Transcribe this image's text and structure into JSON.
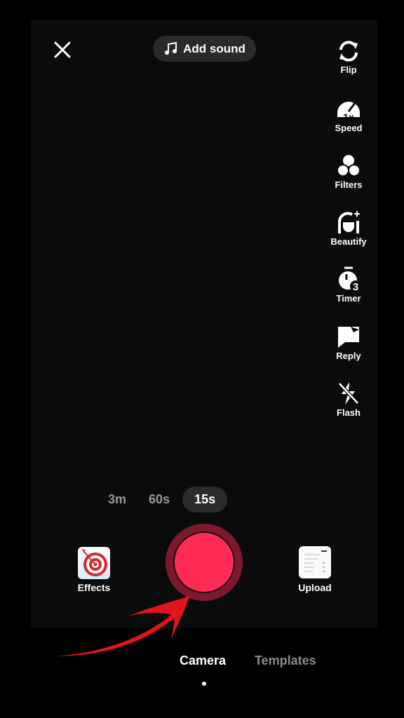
{
  "top": {
    "add_sound_label": "Add sound"
  },
  "side_tools": [
    {
      "label": "Flip",
      "icon": "flip-icon"
    },
    {
      "label": "Speed",
      "icon": "speed-icon",
      "badge": "1x"
    },
    {
      "label": "Filters",
      "icon": "filters-icon"
    },
    {
      "label": "Beautify",
      "icon": "beautify-icon"
    },
    {
      "label": "Timer",
      "icon": "timer-icon",
      "badge": "3"
    },
    {
      "label": "Reply",
      "icon": "reply-icon"
    },
    {
      "label": "Flash",
      "icon": "flash-off-icon"
    }
  ],
  "durations": [
    "3m",
    "60s",
    "15s"
  ],
  "selected_duration": "15s",
  "effects_label": "Effects",
  "upload_label": "Upload",
  "tabs": {
    "camera": "Camera",
    "templates": "Templates"
  },
  "colors": {
    "record": "#fe2c55",
    "annotation_arrow": "#e0141c"
  }
}
